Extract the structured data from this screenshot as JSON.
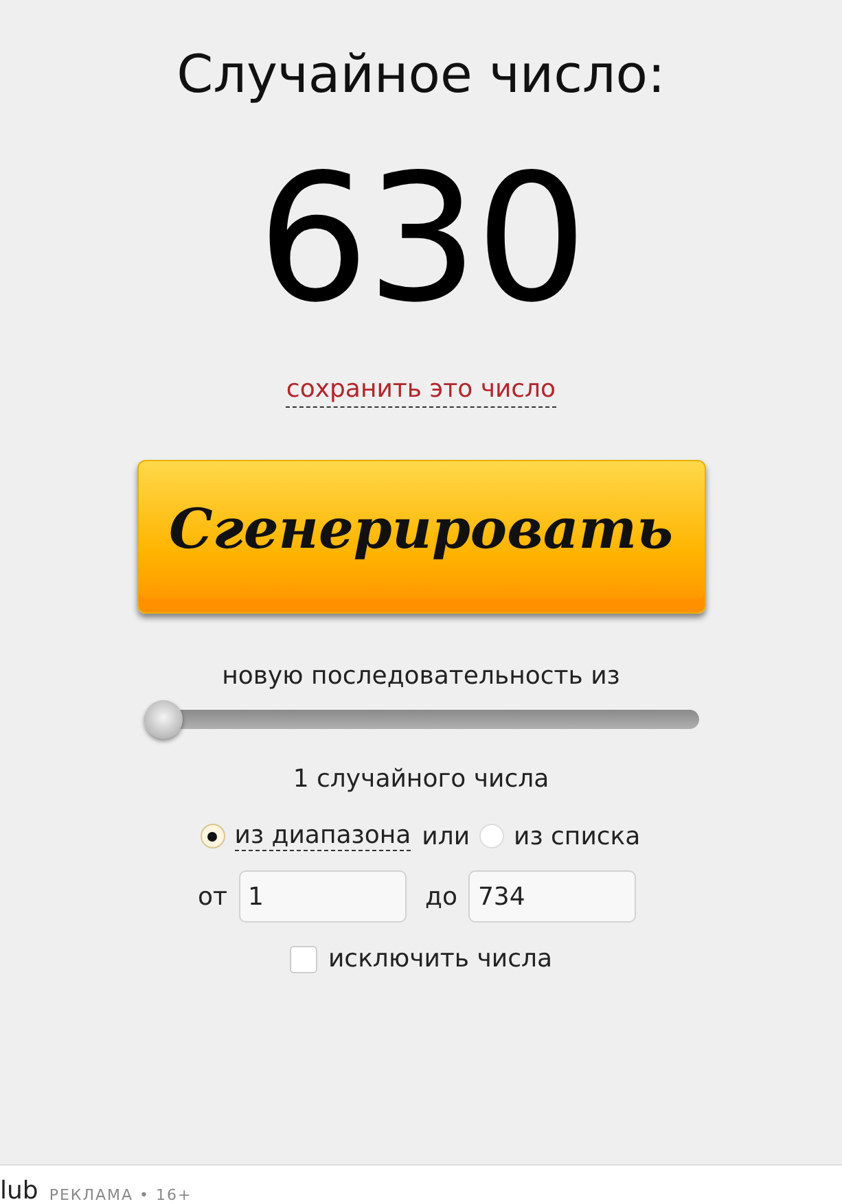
{
  "heading": "Случайное число:",
  "result": "630",
  "save_link": "сохранить это число",
  "generate_button": "Сгенерировать",
  "count_label": "новую последовательность из",
  "count_slider": {
    "level": 0
  },
  "count_text": "1 случайного числа",
  "source_options": [
    {
      "label": "из диапазона",
      "selected": true,
      "dashed": true
    },
    {
      "label": "из списка",
      "selected": false,
      "dashed": false
    }
  ],
  "or_text": "или",
  "range": {
    "from_label": "от",
    "from_value": "1",
    "to_label": "до",
    "to_value": "734"
  },
  "exclude": {
    "label": "исключить числа",
    "checked": false
  },
  "ad_footer": {
    "source": "lub",
    "label": "РЕКЛАМА • 16+"
  }
}
